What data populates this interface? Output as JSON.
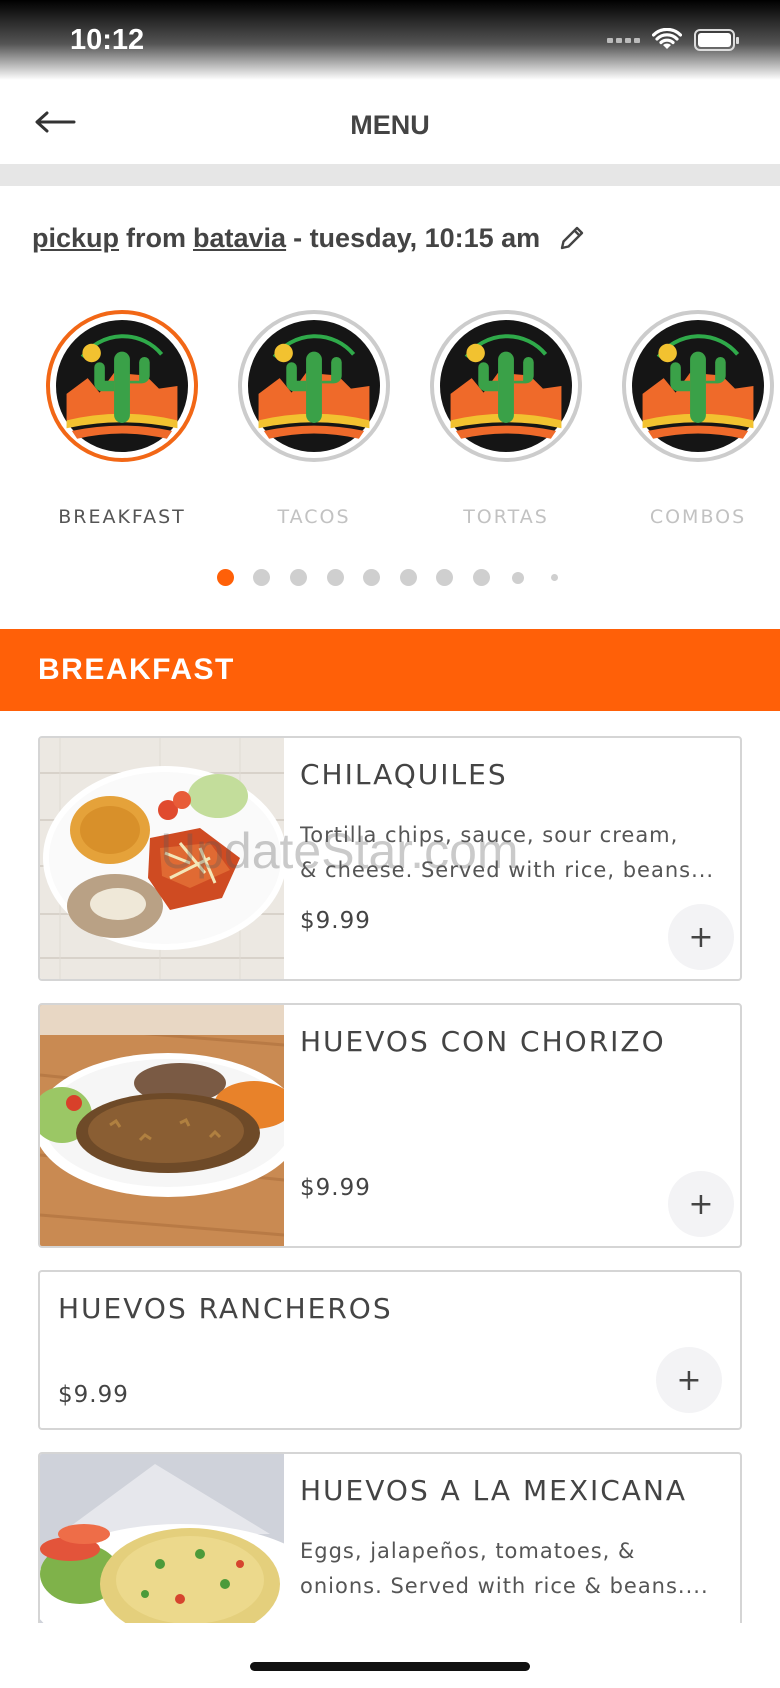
{
  "status_bar": {
    "time": "10:12"
  },
  "nav": {
    "title": "MENU"
  },
  "pickup": {
    "mode": "pickup",
    "from_word": "from",
    "location": "batavia",
    "schedule": "- tuesday, 10:15 am"
  },
  "categories": [
    {
      "label": "BREAKFAST",
      "active": true
    },
    {
      "label": "TACOS",
      "active": false
    },
    {
      "label": "TORTAS",
      "active": false
    },
    {
      "label": "COMBOS",
      "active": false
    }
  ],
  "pagination": {
    "total": 10,
    "current": 1
  },
  "colors": {
    "accent": "#ff6008",
    "inactive_dot": "#cfcfcf",
    "card_border": "#d5d5d5"
  },
  "section": {
    "title": "BREAKFAST"
  },
  "items": [
    {
      "name": "CHILAQUILES",
      "desc_line1": "Tortilla chips, sauce, sour cream,",
      "desc_line2": "& cheese. Served with rice, beans...",
      "price": "$9.99",
      "add_icon": "plus-icon",
      "add_label": "+"
    },
    {
      "name": "HUEVOS CON CHORIZO",
      "price": "$9.99",
      "add_icon": "plus-icon",
      "add_label": "+"
    },
    {
      "name": "HUEVOS RANCHEROS",
      "price": "$9.99",
      "add_icon": "plus-icon",
      "add_label": "+"
    },
    {
      "name": "HUEVOS A LA MEXICANA",
      "desc_line1": "Eggs, jalapeños, tomatoes, &",
      "desc_line2": "onions. Served with rice & beans....",
      "add_icon": "plus-icon"
    }
  ],
  "watermark": "UpdateStar.com"
}
